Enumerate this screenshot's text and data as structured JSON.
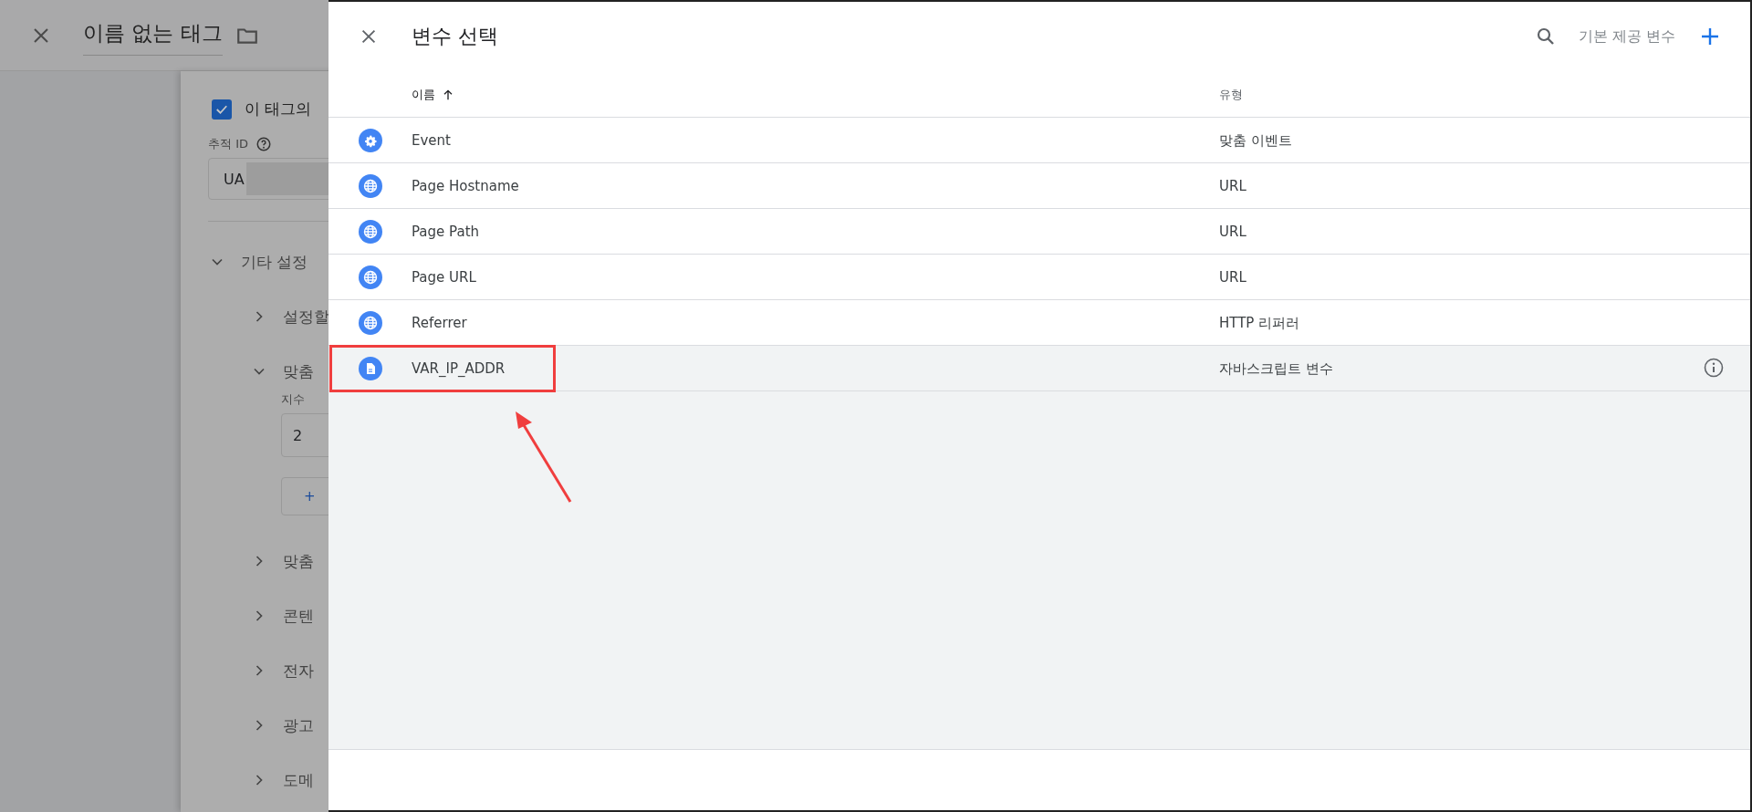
{
  "page": {
    "title": "이름 없는 태그",
    "checkbox": {
      "label": "이 태그의",
      "checked": true
    },
    "tracking_id": {
      "label": "추적 ID",
      "value": "UA"
    },
    "sections": [
      {
        "label": "기타 설정",
        "expanded": true,
        "children": [
          {
            "label": "설정할",
            "expanded": false
          },
          {
            "label": "맞춤",
            "expanded": true,
            "field": {
              "label": "지수",
              "value": "2"
            },
            "button": "+"
          },
          {
            "label": "맞춤",
            "expanded": false
          },
          {
            "label": "콘텐",
            "expanded": false
          },
          {
            "label": "전자",
            "expanded": false
          },
          {
            "label": "광고",
            "expanded": false
          },
          {
            "label": "도메",
            "expanded": false
          }
        ]
      }
    ]
  },
  "panel": {
    "title": "변수 선택",
    "action": "기본 제공 변수",
    "columns": [
      {
        "label": "이름",
        "sorted": true
      },
      {
        "label": "유형",
        "sorted": false
      }
    ],
    "rows": [
      {
        "name": "Event",
        "type": "맞춤 이벤트",
        "kind": "gear",
        "selected": false,
        "annotated": false
      },
      {
        "name": "Page Hostname",
        "type": "URL",
        "kind": "globe",
        "selected": false,
        "annotated": false
      },
      {
        "name": "Page Path",
        "type": "URL",
        "kind": "globe",
        "selected": false,
        "annotated": false
      },
      {
        "name": "Page URL",
        "type": "URL",
        "kind": "globe",
        "selected": false,
        "annotated": false
      },
      {
        "name": "Referrer",
        "type": "HTTP 리퍼러",
        "kind": "globe",
        "selected": false,
        "annotated": false
      },
      {
        "name": "VAR_IP_ADDR",
        "type": "자바스크립트 변수",
        "kind": "doc",
        "selected": true,
        "annotated": true
      }
    ]
  }
}
